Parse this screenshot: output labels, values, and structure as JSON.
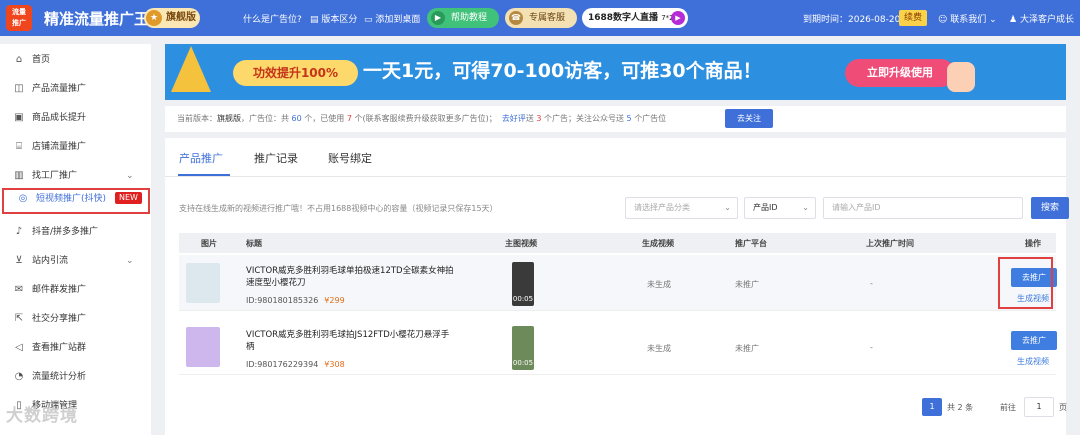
{
  "app": {
    "logo_line1": "流量",
    "logo_line2": "推广",
    "title": "精准流量推广王",
    "edition": "旗舰版"
  },
  "topnav": {
    "links": [
      "什么是广告位?",
      "版本区分",
      "添加到桌面"
    ],
    "help_label": "帮助教程",
    "vip_label": "专属客服",
    "live_label": "1688数字人直播",
    "live_tag": "7*24h",
    "expiry": "到期时间：2026-08-20",
    "renew_label": "续费",
    "contact_label": "联系我们",
    "user_label": "大泽客户成长"
  },
  "sidebar": {
    "items": [
      {
        "label": "首页",
        "icon": "home-icon"
      },
      {
        "label": "产品流量推广",
        "icon": "bag-icon"
      },
      {
        "label": "商品成长提升",
        "icon": "box-icon"
      },
      {
        "label": "店铺流量推广",
        "icon": "shop-icon"
      },
      {
        "label": "找工厂推广",
        "icon": "factory-icon"
      },
      {
        "label": "短视频推广(抖快)",
        "icon": "video-icon",
        "badge": "NEW"
      },
      {
        "label": "抖音/拼多多推广",
        "icon": "tiktok-icon"
      },
      {
        "label": "站内引流",
        "icon": "funnel-icon"
      },
      {
        "label": "邮件群发推广",
        "icon": "mail-icon"
      },
      {
        "label": "社交分享推广",
        "icon": "share-icon"
      },
      {
        "label": "查看推广站群",
        "icon": "megaphone-icon"
      },
      {
        "label": "流量统计分析",
        "icon": "chart-icon"
      },
      {
        "label": "移动端管理",
        "icon": "mobile-icon"
      }
    ]
  },
  "banner": {
    "badge": "功效提升100%",
    "headline": "一天1元，可得70-100访客，可推30个商品！",
    "cta": "立即升级使用"
  },
  "info": {
    "prefix": "当前版本：",
    "edition": "旗舰版",
    "mid1": "，广告位：共",
    "total": "60",
    "mid2": "个，已使用",
    "used": "7",
    "mid3": "个(联系客服续费升级获取更多广告位)；",
    "review_link": "去好评",
    "mid4": "送",
    "review_count": "3",
    "mid5": "个广告；关注公众号送",
    "follow_count": "5",
    "mid6": "个广告位",
    "follow_btn": "去关注"
  },
  "tabs": [
    "产品推广",
    "推广记录",
    "账号绑定"
  ],
  "filter": {
    "hint": "支持在线生成新的视频进行推广哦！不占用1688视频中心的容量（视频记录只保存15天）",
    "category_placeholder": "请选择产品分类",
    "id_select": "产品ID",
    "id_placeholder": "请输入产品ID",
    "search_label": "搜索"
  },
  "table": {
    "headers": [
      "图片",
      "标题",
      "主图视频",
      "生成视频",
      "推广平台",
      "上次推广时间",
      "操作"
    ],
    "rows": [
      {
        "title": "VICTOR威克多胜利羽毛球单拍极速12TD全碳素女神拍速度型小樱花刀",
        "id": "ID:980180185326",
        "price": "¥299",
        "duration": "00:05",
        "gen_video": "未生成",
        "platform": "未推广",
        "last_time": "-",
        "action": "去推广",
        "gen_link": "生成视频"
      },
      {
        "title": "VICTOR威克多胜利羽毛球拍JS12FTD小樱花刀悬浮手柄",
        "id": "ID:980176229394",
        "price": "¥308",
        "duration": "00:05",
        "gen_video": "未生成",
        "platform": "未推广",
        "last_time": "-",
        "action": "去推广",
        "gen_link": "生成视频"
      }
    ]
  },
  "pagination": {
    "current": "1",
    "total": "共 2 条",
    "goto": "前往",
    "page_value": "1",
    "page_unit": "页"
  },
  "watermark": "大数跨境",
  "colors": {
    "primary": "#3f6fd8",
    "highlight": "#e04040",
    "price": "#e0701a"
  }
}
